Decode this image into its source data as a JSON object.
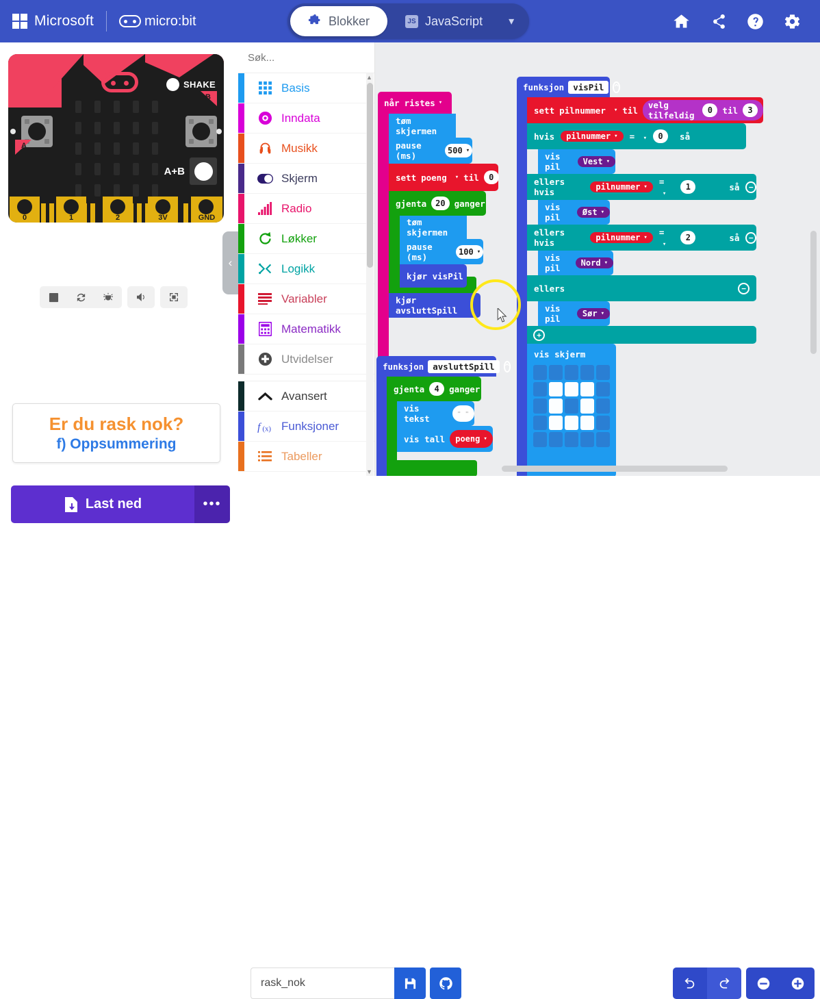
{
  "header": {
    "brand_microsoft": "Microsoft",
    "brand_microbit": "micro:bit",
    "tabs": [
      {
        "label": "Blokker",
        "icon": "puzzle-icon",
        "active": true
      },
      {
        "label": "JavaScript",
        "icon": "js-badge-icon",
        "active": false
      }
    ],
    "chevron": "▾",
    "icons": [
      "home-icon",
      "share-icon",
      "help-icon",
      "gear-icon"
    ],
    "bg_color": "#3a53c4",
    "tab_group_bg": "#31459f"
  },
  "simulator": {
    "board": {
      "shake_label": "SHAKE",
      "ab_label": "A+B",
      "button_a_label": "A",
      "button_b_label": "B",
      "pin_labels": [
        "0",
        "1",
        "2",
        "3V",
        "GND"
      ],
      "accent_color": "#f0415f",
      "body_color": "#1d1d1d",
      "pin_color": "#e2b011"
    },
    "toolbar": [
      "stop-icon",
      "restart-icon",
      "debug-icon",
      "sound-icon",
      "fullscreen-icon"
    ]
  },
  "tutorial": {
    "title": "Er du rask nok?",
    "subtitle": "f) Oppsummering",
    "title_color": "#f59130",
    "subtitle_color": "#2d7ae5"
  },
  "toolbox": {
    "search_placeholder": "Søk...",
    "search_value": "",
    "categories": [
      {
        "label": "Basis",
        "color": "#1e9bf0",
        "icon": "grid-icon"
      },
      {
        "label": "Inndata",
        "color": "#d800d8",
        "icon": "donut-icon"
      },
      {
        "label": "Musikk",
        "color": "#e8501e",
        "icon": "headphones-icon"
      },
      {
        "label": "Skjerm",
        "color": "#4a2a8a",
        "icon": "toggle-icon"
      },
      {
        "label": "Radio",
        "color": "#e8156b",
        "icon": "signal-bars-icon"
      },
      {
        "label": "Løkker",
        "color": "#13a10e",
        "icon": "loop-arrow-icon"
      },
      {
        "label": "Logikk",
        "color": "#00a3a3",
        "icon": "shuffle-icon"
      },
      {
        "label": "Variabler",
        "color": "#e8152c",
        "icon": "lines-icon"
      },
      {
        "label": "Matematikk",
        "color": "#9b00e8",
        "icon": "calculator-icon"
      },
      {
        "label": "Utvidelser",
        "color": "#7a7a7a",
        "icon": "plus-circle-icon"
      }
    ],
    "advanced": [
      {
        "label": "Avansert",
        "color": "#0d2b2b",
        "icon": "chevron-up-icon"
      },
      {
        "label": "Funksjoner",
        "color": "#3b4fd8",
        "icon": "fx-icon"
      },
      {
        "label": "Tabeller",
        "color": "#e8701e",
        "icon": "list-icon"
      }
    ],
    "collapse_handle": "‹"
  },
  "workspace": {
    "stack_on_shake": {
      "event_label": "når",
      "event_value": "ristes",
      "children": [
        {
          "label": "tøm skjermen"
        },
        {
          "label": "pause (ms)",
          "value": "500"
        },
        {
          "label_a": "sett",
          "var": "poeng",
          "label_b": "til",
          "value": "0"
        },
        {
          "label_a": "gjenta",
          "value": "20",
          "label_b": "ganger",
          "children": [
            {
              "label": "tøm skjermen"
            },
            {
              "label": "pause (ms)",
              "value": "100"
            },
            {
              "label": "kjør visPil"
            }
          ]
        },
        {
          "label": "kjør avsluttSpill"
        }
      ]
    },
    "stack_vispil": {
      "fn_label": "funksjon",
      "fn_name": "visPil",
      "set_label_a": "sett",
      "set_var": "pilnummer",
      "set_label_b": "til",
      "random_label": "velg tilfeldig",
      "random_from": "0",
      "random_to": "3",
      "branches": [
        {
          "keyword": "hvis",
          "var": "pilnummer",
          "op": "=",
          "value": "0",
          "then_label": "så",
          "body_label": "vis pil",
          "body_value": "Vest"
        },
        {
          "keyword": "ellers hvis",
          "var": "pilnummer",
          "op": "=",
          "value": "1",
          "then_label": "så",
          "body_label": "vis pil",
          "body_value": "Øst"
        },
        {
          "keyword": "ellers hvis",
          "var": "pilnummer",
          "op": "=",
          "value": "2",
          "then_label": "så",
          "body_label": "vis pil",
          "body_value": "Nord"
        },
        {
          "keyword": "ellers",
          "var": "",
          "op": "",
          "value": "",
          "then_label": "",
          "body_label": "vis pil",
          "body_value": "Sør"
        }
      ],
      "show_leds_label": "vis skjerm",
      "led_pattern": [
        [
          0,
          0,
          0,
          0,
          0
        ],
        [
          0,
          1,
          1,
          1,
          0
        ],
        [
          0,
          1,
          0,
          1,
          0
        ],
        [
          0,
          1,
          1,
          1,
          0
        ],
        [
          0,
          0,
          0,
          0,
          0
        ]
      ]
    },
    "stack_avslutt": {
      "fn_label": "funksjon",
      "fn_name": "avsluttSpill",
      "repeat_label_a": "gjenta",
      "repeat_value": "4",
      "repeat_label_b": "ganger",
      "show_text_label": "vis tekst",
      "show_text_value": "\" \"",
      "show_number_label": "vis tall",
      "show_number_var": "poeng"
    },
    "colors": {
      "event": "#e3008c",
      "basic": "#1e9bf0",
      "variables": "#e8152c",
      "loops": "#13a10e",
      "logic": "#00a3a3",
      "functions": "#3b4fd8",
      "math": "#b432c8",
      "led_value": "#6b1a8f",
      "canvas": "#ecedef"
    },
    "cursor_highlight_color": "#ffe81a"
  },
  "footer": {
    "download_label": "Last ned",
    "download_more": "•••",
    "project_name": "rask_nok",
    "project_placeholder": "",
    "save_icon": "floppy-disk-icon",
    "github_icon": "github-icon",
    "undo_icon": "undo-icon",
    "redo_icon": "redo-icon",
    "zoom_out_icon": "minus-circle-icon",
    "zoom_in_icon": "plus-circle-icon",
    "download_color": "#5d2fcf",
    "control_color": "#2f49c9"
  }
}
